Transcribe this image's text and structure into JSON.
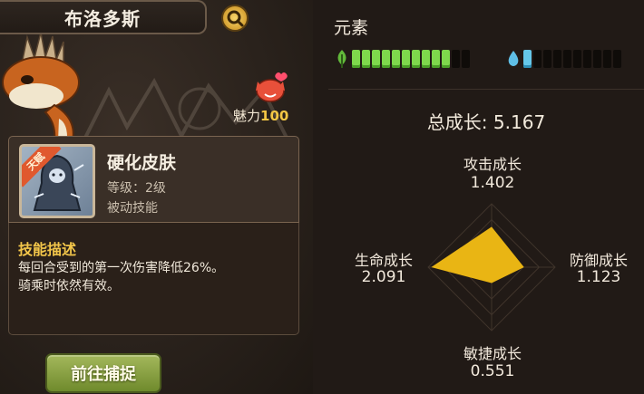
{
  "header": {
    "creature_name": "布洛多斯"
  },
  "charm": {
    "label": "魅力",
    "value": "100"
  },
  "skill": {
    "badge": "天赋",
    "name": "硬化皮肤",
    "level": "等级：2级",
    "type": "被动技能"
  },
  "description": {
    "title": "技能描述",
    "line1": "每回合受到的第一次伤害降低26%。",
    "line2": "骑乘时依然有效。"
  },
  "capture_button": {
    "label": "前往捕捉"
  },
  "elements": {
    "title": "元素",
    "nature": {
      "icon": "leaf-icon",
      "filled": 10,
      "total": 12
    },
    "water": {
      "icon": "water-drop-icon",
      "filled": 1,
      "total": 10
    }
  },
  "growth": {
    "total_label": "总成长: 5.167",
    "attack": {
      "label": "攻击成长",
      "value": "1.402"
    },
    "defense": {
      "label": "防御成长",
      "value": "1.123"
    },
    "agility": {
      "label": "敏捷成长",
      "value": "0.551"
    },
    "hp": {
      "label": "生命成长",
      "value": "2.091"
    }
  },
  "radar_values": {
    "attack": 1.402,
    "defense": 1.123,
    "agility": 0.551,
    "hp": 2.091,
    "max": 2.2
  },
  "colors": {
    "radar_fill": "#e9b514",
    "accent_gold": "#f3c64a",
    "nature_green": "#7ed84c",
    "water_blue": "#65c8ea"
  }
}
